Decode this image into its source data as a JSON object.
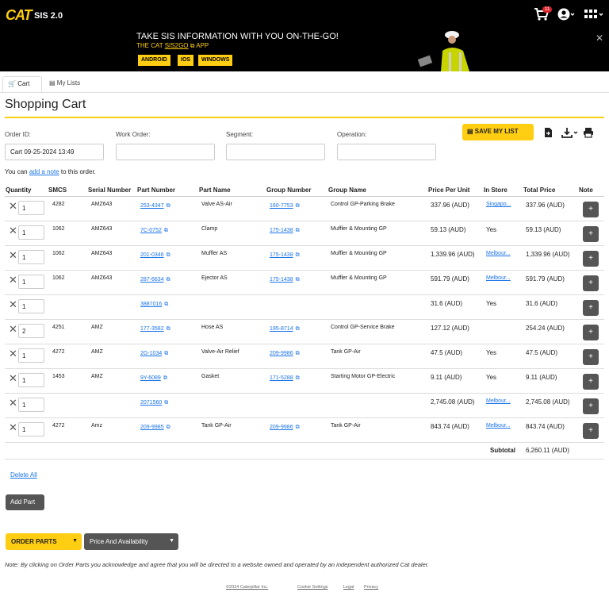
{
  "header": {
    "logo": "CAT",
    "product": "SIS 2.0",
    "cart_count": "11"
  },
  "banner": {
    "title": "TAKE SIS INFORMATION WITH YOU ON-THE-GO!",
    "sub_prefix": "THE CAT ",
    "sub_link": "SIS2GO",
    "sub_suffix": " APP",
    "buttons": [
      "ANDROID",
      "IOS",
      "WINDOWS"
    ],
    "close": "✕"
  },
  "tabs": [
    {
      "label": "Cart"
    },
    {
      "label": "My Lists"
    }
  ],
  "page_title": "Shopping Cart",
  "form": {
    "order_id_label": "Order ID:",
    "order_id_value": "Cart 09-25-2024 13:49",
    "work_order_label": "Work Order:",
    "segment_label": "Segment:",
    "operation_label": "Operation:"
  },
  "save_list_label": "SAVE MY LIST",
  "note_line": {
    "prefix": "You can ",
    "link": "add a note",
    "suffix": " to this order."
  },
  "columns": [
    "Quantity",
    "SMCS",
    "Serial Number",
    "Part Number",
    "Part Name",
    "Group Number",
    "Group Name",
    "Price Per Unit",
    "In Store",
    "Total Price",
    "Note"
  ],
  "rows": [
    {
      "qty": "1",
      "smcs": "4282",
      "serial": "AMZ643",
      "part_no": "253-4347",
      "part_name": "Valve AS-Air",
      "group_no": "160-7753",
      "group_name": "Control GP-Parking Brake",
      "price": "337.96 (AUD)",
      "store": "Singapo...",
      "store_link": true,
      "total": "337.96 (AUD)"
    },
    {
      "qty": "1",
      "smcs": "1062",
      "serial": "AMZ643",
      "part_no": "7C-0752",
      "part_name": "Clamp",
      "group_no": "175-1438",
      "group_name": "Muffler & Mounting GP",
      "price": "59.13 (AUD)",
      "store": "Yes",
      "store_link": false,
      "total": "59.13 (AUD)"
    },
    {
      "qty": "1",
      "smcs": "1062",
      "serial": "AMZ643",
      "part_no": "201-0346",
      "part_name": "Muffler AS",
      "group_no": "175-1438",
      "group_name": "Muffler & Mounting GP",
      "price": "1,339.96 (AUD)",
      "store": "Melbour...",
      "store_link": true,
      "total": "1,339.96 (AUD)"
    },
    {
      "qty": "1",
      "smcs": "1062",
      "serial": "AMZ643",
      "part_no": "287-6634",
      "part_name": "Ejector AS",
      "group_no": "175-1438",
      "group_name": "Muffler & Mounting GP",
      "price": "591.79 (AUD)",
      "store": "Melbour...",
      "store_link": true,
      "total": "591.79 (AUD)"
    },
    {
      "qty": "1",
      "smcs": "",
      "serial": "",
      "part_no": "3887016",
      "part_name": "",
      "group_no": "",
      "group_name": "",
      "price": "31.6 (AUD)",
      "store": "Yes",
      "store_link": false,
      "total": "31.6 (AUD)"
    },
    {
      "qty": "2",
      "smcs": "4251",
      "serial": "AMZ",
      "part_no": "177-3582",
      "part_name": "Hose AS",
      "group_no": "195-8714",
      "group_name": "Control GP-Service Brake",
      "price": "127.12 (AUD)",
      "store": "",
      "store_link": false,
      "total": "254.24 (AUD)"
    },
    {
      "qty": "1",
      "smcs": "4272",
      "serial": "AMZ",
      "part_no": "2G-1034",
      "part_name": "Valve-Air Relief",
      "group_no": "209-9986",
      "group_name": "Tank GP-Air",
      "price": "47.5 (AUD)",
      "store": "Yes",
      "store_link": false,
      "total": "47.5 (AUD)"
    },
    {
      "qty": "1",
      "smcs": "1453",
      "serial": "AMZ",
      "part_no": "9Y-6089",
      "part_name": "Gasket",
      "group_no": "171-5288",
      "group_name": "Starting Motor GP-Electric",
      "price": "9.11 (AUD)",
      "store": "Yes",
      "store_link": false,
      "total": "9.11 (AUD)"
    },
    {
      "qty": "1",
      "smcs": "",
      "serial": "",
      "part_no": "2071560",
      "part_name": "",
      "group_no": "",
      "group_name": "",
      "price": "2,745.08 (AUD)",
      "store": "Melbour...",
      "store_link": true,
      "total": "2,745.08 (AUD)"
    },
    {
      "qty": "1",
      "smcs": "4272",
      "serial": "Amz",
      "part_no": "209-9985",
      "part_name": "Tank GP-Air",
      "group_no": "209-9986",
      "group_name": "Tank GP-Air",
      "price": "843.74 (AUD)",
      "store": "Melbour...",
      "store_link": true,
      "total": "843.74 (AUD)"
    }
  ],
  "subtotal_label": "Subtotal",
  "subtotal_value": "6,260.11 (AUD)",
  "delete_all": "Delete All",
  "add_part": "Add Part",
  "order_parts": "ORDER PARTS",
  "price_availability": "Price And Availability",
  "disclaimer": "Note: By clicking on Order Parts you acknowledge and agree that you will be directed to a website owned and operated by an independent authorized Cat dealer.",
  "footer": [
    "©2024 Caterpillar Inc.",
    "Cookie Settings",
    "Legal",
    "Privacy"
  ],
  "colors": {
    "accent": "#ffcd11",
    "link": "#1a73e8",
    "dark": "#000000"
  }
}
